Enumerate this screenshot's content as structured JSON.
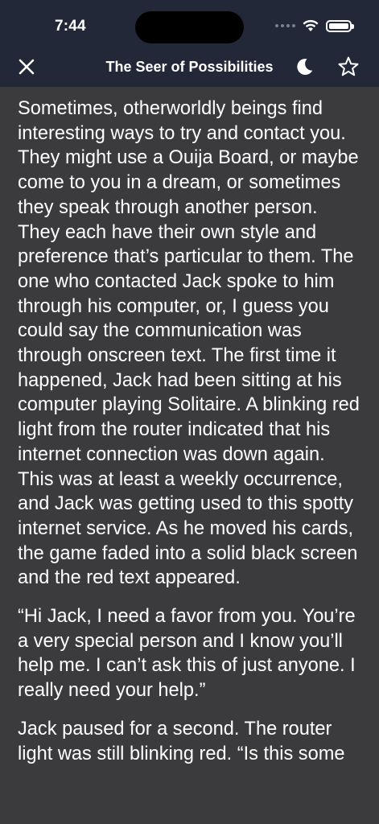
{
  "status_bar": {
    "time": "7:44"
  },
  "nav": {
    "title": "The Seer of Possibilities",
    "close_icon": "close-icon",
    "theme_icon": "moon-icon",
    "favorite_icon": "star-icon"
  },
  "story": {
    "paragraphs": [
      "Sometimes, otherworldly beings find interesting ways to try and contact you. They might use a Ouija Board, or maybe come to you in a dream, or sometimes they speak through another person. They each have their own style and preference that’s particular to them. The one who contacted Jack spoke to him through his computer, or, I guess you could say the communication was through onscreen text. The first time it happened, Jack had been sitting at his computer playing Solitaire. A blinking red light from the router indicated that his internet connection was down again. This was at least a weekly occurrence, and Jack was getting used to this spotty internet service. As he moved his cards, the game faded into a solid black screen and the red text appeared.",
      "“Hi Jack, I need a favor from you. You’re a very special person and I know you’ll help me. I can’t ask this of just anyone. I really need your help.”",
      "Jack paused for a second. The router light was still blinking red. “Is this some"
    ]
  }
}
